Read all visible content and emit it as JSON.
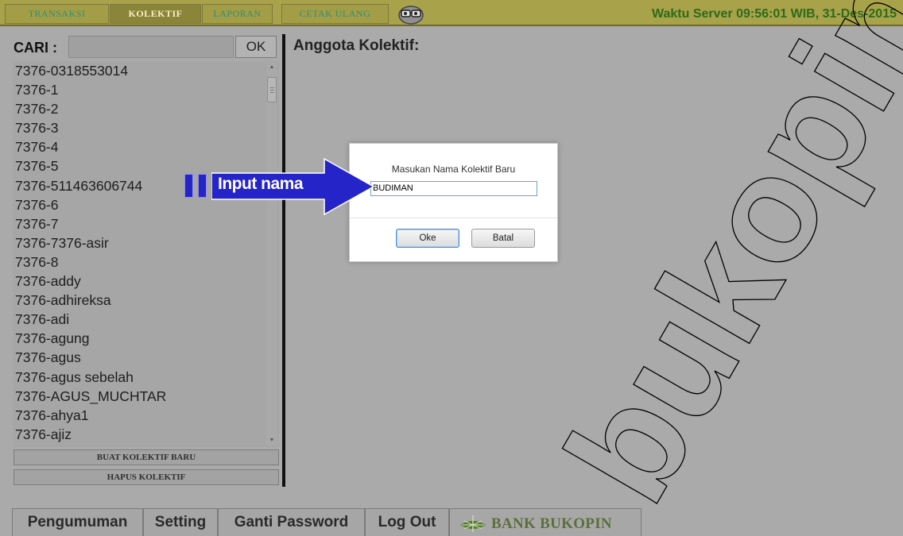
{
  "topbar": {
    "tabs": [
      {
        "label": "TRANSAKSI",
        "active": false
      },
      {
        "label": "KOLEKTIF",
        "active": true
      },
      {
        "label": "LAPORAN",
        "active": false
      },
      {
        "label": "CETAK ULANG",
        "active": false
      }
    ],
    "mascot_icon": "owl-glasses-icon",
    "server_time": "Waktu Server 09:56:01 WIB, 31-Des-2015"
  },
  "search": {
    "label": "CARI :",
    "value": "",
    "button_label": "OK"
  },
  "kolektif_list": [
    "7376-0318553014",
    "7376-1",
    "7376-2",
    "7376-3",
    "7376-4",
    "7376-5",
    "7376-511463606744",
    "7376-6",
    "7376-7",
    "7376-7376-asir",
    "7376-8",
    "7376-addy",
    "7376-adhireksa",
    "7376-adi",
    "7376-agung",
    "7376-agus",
    "7376-agus sebelah",
    "7376-AGUS_MUCHTAR",
    "7376-ahya1",
    "7376-ajiz"
  ],
  "side_buttons": {
    "create": "BUAT KOLEKTIF BARU",
    "delete": "HAPUS KOLEKTIF"
  },
  "main": {
    "title": "Anggota Kolektif:"
  },
  "dialog": {
    "prompt": "Masukan Nama Kolektif Baru",
    "input_value": "BUDIMAN",
    "ok_label": "Oke",
    "cancel_label": "Batal"
  },
  "annotation": {
    "label": "Input nama",
    "color": "#2424c8"
  },
  "bottom_tabs": {
    "announcement": "Pengumuman",
    "setting": "Setting",
    "change_password": "Ganti Password",
    "logout": "Log Out"
  },
  "brand": {
    "name": "BANK BUKOPIN",
    "color": "#5b6f3b"
  },
  "watermark": {
    "text": "bukopin.co.id"
  }
}
